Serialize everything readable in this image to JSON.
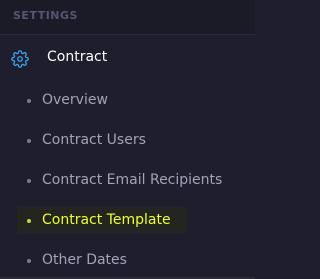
{
  "section": {
    "title": "SETTINGS"
  },
  "menu": {
    "parent": {
      "label": "Contract",
      "icon": "gear-icon"
    },
    "items": [
      {
        "label": "Overview",
        "active": false
      },
      {
        "label": "Contract Users",
        "active": false
      },
      {
        "label": "Contract Email Recipients",
        "active": false
      },
      {
        "label": "Contract Template",
        "active": true
      },
      {
        "label": "Other Dates",
        "active": false
      }
    ]
  },
  "colors": {
    "background": "#1e1e2d",
    "accent": "#ecff3a",
    "icon": "#3b9ee8"
  }
}
